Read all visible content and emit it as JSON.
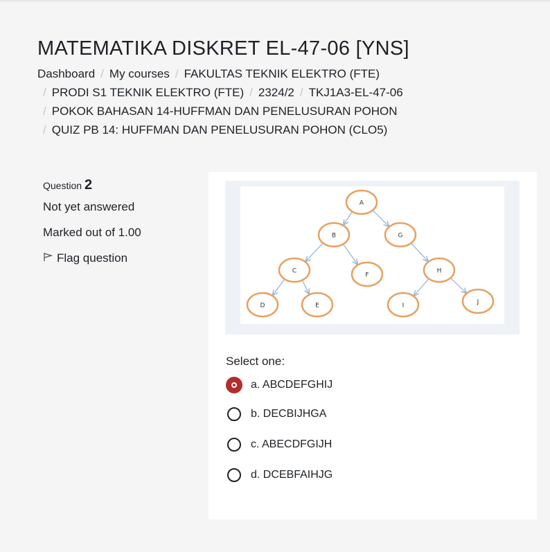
{
  "page_title": "MATEMATIKA DISKRET EL-47-06 [YNS]",
  "breadcrumb": {
    "items": [
      "Dashboard",
      "My courses",
      "FAKULTAS TEKNIK ELEKTRO (FTE)",
      "PRODI S1 TEKNIK ELEKTRO (FTE)",
      "2324/2",
      "TKJ1A3-EL-47-06",
      "POKOK BAHASAN 14-HUFFMAN DAN PENELUSURAN POHON",
      "QUIZ PB 14: HUFFMAN DAN PENELUSURAN POHON (CLO5)"
    ],
    "separator": "/"
  },
  "question_info": {
    "label": "Question",
    "number": "2",
    "status": "Not yet answered",
    "marks": "Marked out of 1.00",
    "flag_label": "Flag question"
  },
  "tree": {
    "node_color": "#e8a060",
    "edge_color": "#9bb5d6",
    "nodes": [
      "A",
      "B",
      "G",
      "C",
      "F",
      "H",
      "D",
      "E",
      "I",
      "J"
    ],
    "edges": [
      [
        "A",
        "B"
      ],
      [
        "A",
        "G"
      ],
      [
        "B",
        "C"
      ],
      [
        "B",
        "F"
      ],
      [
        "G",
        "H"
      ],
      [
        "C",
        "D"
      ],
      [
        "C",
        "E"
      ],
      [
        "H",
        "I"
      ],
      [
        "H",
        "J"
      ]
    ]
  },
  "answer": {
    "prompt": "Select one:",
    "options": [
      {
        "label": "a. ABCDEFGHIJ",
        "selected": true
      },
      {
        "label": "b. DECBIJHGA",
        "selected": false
      },
      {
        "label": "c. ABECDFGIJH",
        "selected": false
      },
      {
        "label": "d. DCEBFAIHJG",
        "selected": false
      }
    ],
    "selected_color": "#b22d2d"
  }
}
